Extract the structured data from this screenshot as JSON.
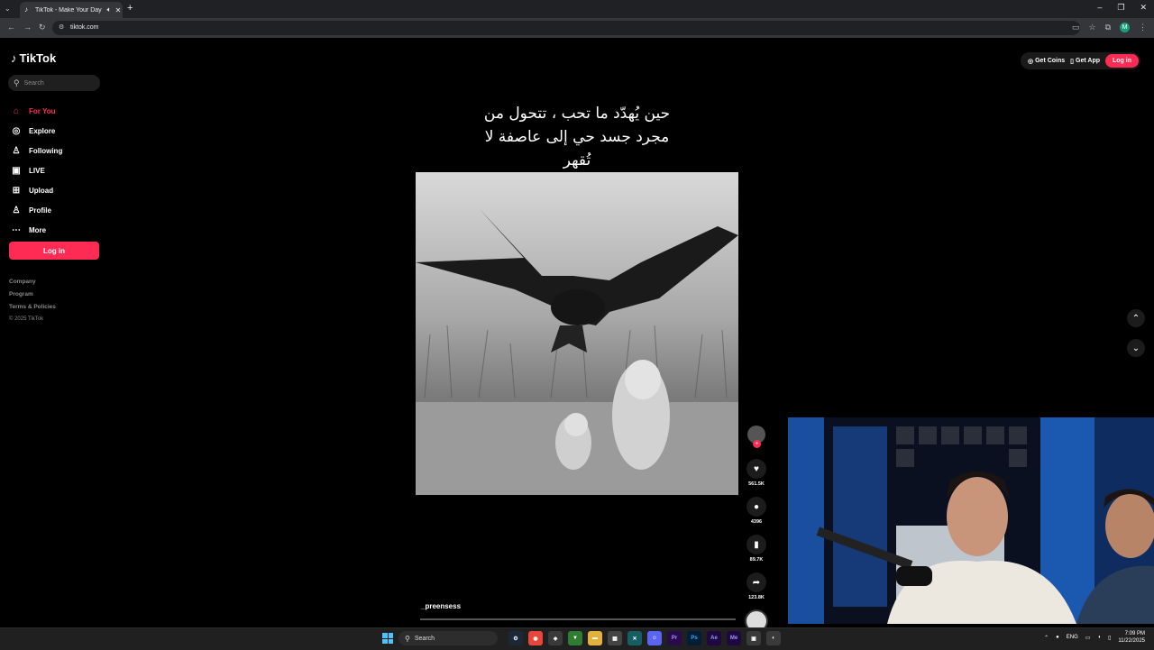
{
  "browser": {
    "tab_title": "TikTok - Make Your Day",
    "url": "tiktok.com",
    "avatar_initial": "M"
  },
  "tiktok": {
    "logo_text": "TikTok",
    "search_placeholder": "Search",
    "nav": [
      {
        "label": "For You",
        "icon": "home-icon"
      },
      {
        "label": "Explore",
        "icon": "compass-icon"
      },
      {
        "label": "Following",
        "icon": "following-icon"
      },
      {
        "label": "LIVE",
        "icon": "live-icon"
      },
      {
        "label": "Upload",
        "icon": "upload-icon"
      },
      {
        "label": "Profile",
        "icon": "profile-icon"
      },
      {
        "label": "More",
        "icon": "more-icon"
      }
    ],
    "login_label": "Log in",
    "footer": {
      "company": "Company",
      "program": "Program",
      "terms": "Terms & Policies",
      "copyright": "© 2025 TikTok"
    },
    "top": {
      "get_coins": "Get Coins",
      "get_app": "Get App",
      "login": "Log in"
    }
  },
  "video": {
    "caption_line1": "حين يُهدّد ما تحب ، تتحول من",
    "caption_line2": "مجرد جسد حي إلى عاصفة لا",
    "caption_line3": "تُقهر",
    "author": "_preensess",
    "likes": "561.5K",
    "comments": "4396",
    "saves": "89.7K",
    "shares": "123.8K"
  },
  "taskbar": {
    "search_label": "Search",
    "apps": [
      "Pr",
      "Ps",
      "Ae",
      "Me"
    ],
    "lang": "ENG",
    "time": "7:09 PM",
    "date": "11/22/2025"
  },
  "colors": {
    "accent": "#fe2c55",
    "background": "#000000"
  }
}
